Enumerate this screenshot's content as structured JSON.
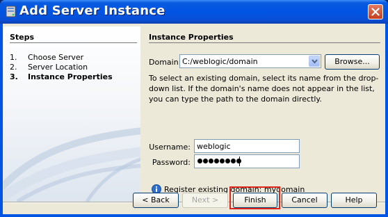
{
  "window": {
    "title": "Add Server Instance"
  },
  "steps": {
    "title": "Steps",
    "items": [
      {
        "num": "1.",
        "label": "Choose Server"
      },
      {
        "num": "2.",
        "label": "Server Location"
      },
      {
        "num": "3.",
        "label": "Instance Properties"
      }
    ],
    "current_index": 2
  },
  "instance": {
    "title": "Instance Properties",
    "domain_label": "Domain:",
    "domain_value": "C:/weblogic/domain",
    "browse_label": "Browse...",
    "help_text": "To select an existing domain, select its name from the drop-down list. If the domain's name does not appear in the list, you can type the path to the domain directly.",
    "username_label": "Username:",
    "username_value": "weblogic",
    "password_label": "Password:",
    "password_length": 8,
    "info_text": "Register existing domain: mydomain"
  },
  "buttons": {
    "back": "< Back",
    "next": "Next >",
    "finish": "Finish",
    "cancel": "Cancel",
    "help": "Help"
  },
  "colors": {
    "titlebar": "#0054e3",
    "highlight": "#e0261a",
    "dialog_bg": "#ece9d8"
  }
}
